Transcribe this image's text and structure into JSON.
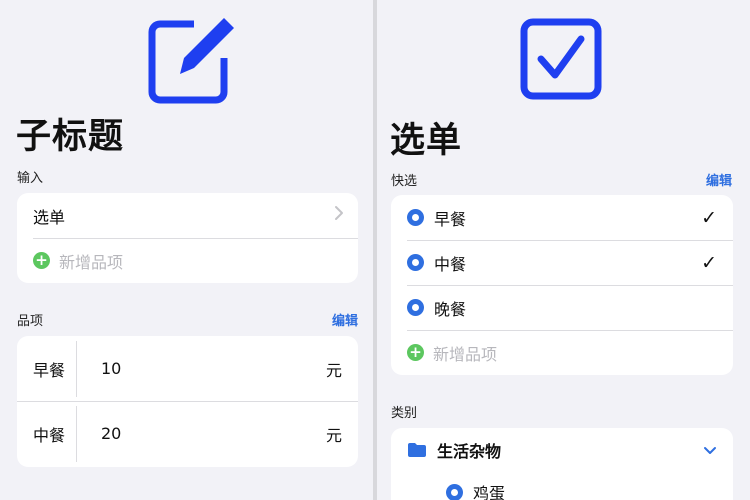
{
  "left": {
    "title": "子标题",
    "input_section": {
      "label": "输入",
      "menu_item": "选单",
      "add_item": "新增品项"
    },
    "items_section": {
      "label": "品项",
      "edit": "编辑",
      "rows": [
        {
          "name": "早餐",
          "value": "10",
          "unit": "元"
        },
        {
          "name": "中餐",
          "value": "20",
          "unit": "元"
        }
      ]
    }
  },
  "right": {
    "title": "选单",
    "quick_section": {
      "label": "快选",
      "edit": "编辑",
      "options": [
        {
          "label": "早餐",
          "checked": true,
          "check_mark": "✓"
        },
        {
          "label": "中餐",
          "checked": true,
          "check_mark": "✓"
        },
        {
          "label": "晚餐",
          "checked": false,
          "check_mark": ""
        }
      ],
      "add_item": "新增品项"
    },
    "category_section": {
      "label": "类别",
      "folder": "生活杂物",
      "child": "鸡蛋"
    }
  },
  "colors": {
    "accent": "#2f6fe0",
    "icon_blue": "#1f3ff0",
    "add_green": "#5cc75f",
    "background": "#f2f2f7"
  },
  "icons": {
    "left_hero": "square-pencil-icon",
    "right_hero": "checkbox-icon",
    "chevron": "chevron-right-icon",
    "folder": "folder-icon",
    "expand": "chevron-down-icon"
  }
}
